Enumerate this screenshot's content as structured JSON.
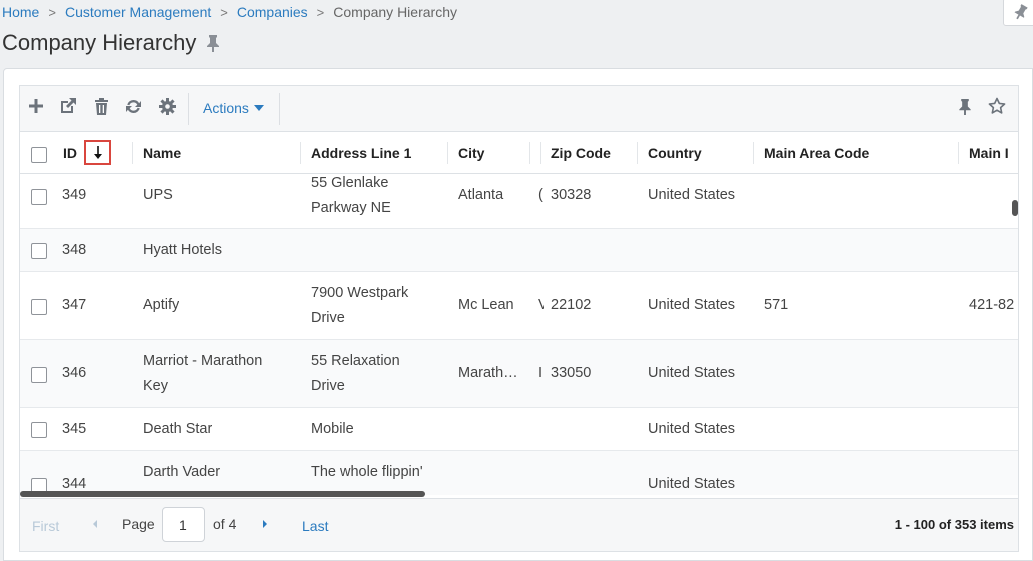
{
  "breadcrumb": {
    "items": [
      "Home",
      "Customer Management",
      "Companies"
    ],
    "current": "Company Hierarchy"
  },
  "page": {
    "title": "Company Hierarchy"
  },
  "toolbar": {
    "icons": [
      "add-icon",
      "open-external-icon",
      "delete-icon",
      "refresh-icon",
      "settings-icon"
    ],
    "actions_label": "Actions",
    "right_icons": [
      "pin-icon",
      "star-icon"
    ]
  },
  "columns": [
    "ID",
    "Name",
    "Address Line 1",
    "City",
    "Zip Code",
    "Country",
    "Main Area Code",
    "Main I"
  ],
  "sort": {
    "column": "ID",
    "direction": "descending"
  },
  "rows": [
    {
      "id": "349",
      "name": "UPS",
      "address": "55 Glenlake Parkway NE",
      "city": "Atlanta",
      "state": "(",
      "zip": "30328",
      "country": "United States",
      "area": "",
      "phone": ""
    },
    {
      "id": "348",
      "name": "Hyatt Hotels",
      "address": "",
      "city": "",
      "state": "",
      "zip": "",
      "country": "",
      "area": "",
      "phone": ""
    },
    {
      "id": "347",
      "name": "Aptify",
      "address": "7900 Westpark Drive",
      "city": "Mc Lean",
      "state": "V",
      "zip": "22102",
      "country": "United States",
      "area": "571",
      "phone": "421-82"
    },
    {
      "id": "346",
      "name": "Marriot - Marathon Key",
      "address": "55 Relaxation Drive",
      "city": "Marath…",
      "state": "I",
      "zip": "33050",
      "country": "United States",
      "area": "",
      "phone": ""
    },
    {
      "id": "345",
      "name": "Death Star",
      "address": "Mobile",
      "city": "",
      "state": "",
      "zip": "",
      "country": "United States",
      "area": "",
      "phone": ""
    },
    {
      "id": "344",
      "name": "Darth Vader",
      "address": "The whole flippin'",
      "city": "",
      "state": "",
      "zip": "",
      "country": "United States",
      "area": "",
      "phone": ""
    }
  ],
  "pager": {
    "first": "First",
    "page_label": "Page",
    "current_page": "1",
    "of_label": "of 4",
    "last": "Last",
    "info": "1 - 100 of 353 items"
  },
  "colors": {
    "link": "#2b7bbf",
    "sort_highlight": "#d9463e"
  }
}
